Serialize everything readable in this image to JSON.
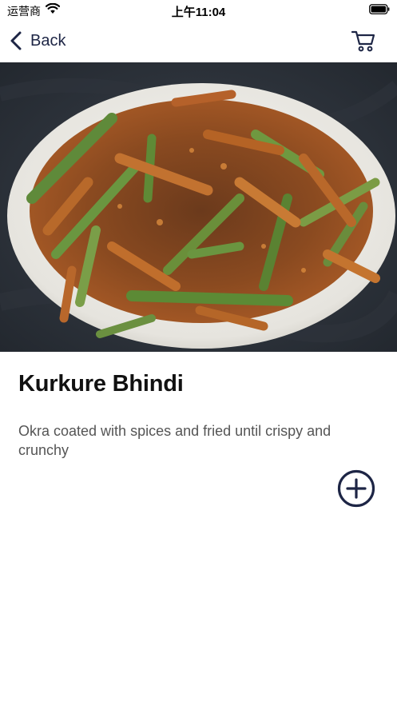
{
  "status_bar": {
    "carrier": "运营商",
    "time": "上午11:04"
  },
  "nav": {
    "back_label": "Back"
  },
  "product": {
    "name": "Kurkure Bhindi",
    "description": "Okra coated with spices and fried until crispy and crunchy"
  },
  "colors": {
    "accent": "#1d2545",
    "text_primary": "#111111",
    "text_secondary": "#555555"
  },
  "icons": {
    "back": "chevron-left-icon",
    "cart": "cart-icon",
    "add": "plus-circle-icon"
  }
}
